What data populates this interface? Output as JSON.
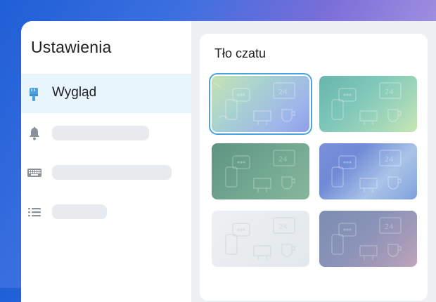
{
  "sidebar": {
    "title": "Ustawienia",
    "items": [
      {
        "icon": "brush-icon",
        "label": "Wygląd",
        "active": true
      },
      {
        "icon": "bell-icon",
        "label": "",
        "active": false
      },
      {
        "icon": "keyboard-icon",
        "label": "",
        "active": false
      },
      {
        "icon": "list-icon",
        "label": "",
        "active": false
      }
    ]
  },
  "panel": {
    "title": "Tło czatu",
    "wallpapers": [
      {
        "name": "wallpaper-1",
        "selected": true
      },
      {
        "name": "wallpaper-2",
        "selected": false
      },
      {
        "name": "wallpaper-3",
        "selected": false
      },
      {
        "name": "wallpaper-4",
        "selected": false
      },
      {
        "name": "wallpaper-5",
        "selected": false
      },
      {
        "name": "wallpaper-6",
        "selected": false
      }
    ]
  },
  "colors": {
    "accent": "#4aa3e0",
    "active_bg": "#e9f5fd",
    "icon": "#8a9199",
    "brush": "#4aa3e0"
  }
}
